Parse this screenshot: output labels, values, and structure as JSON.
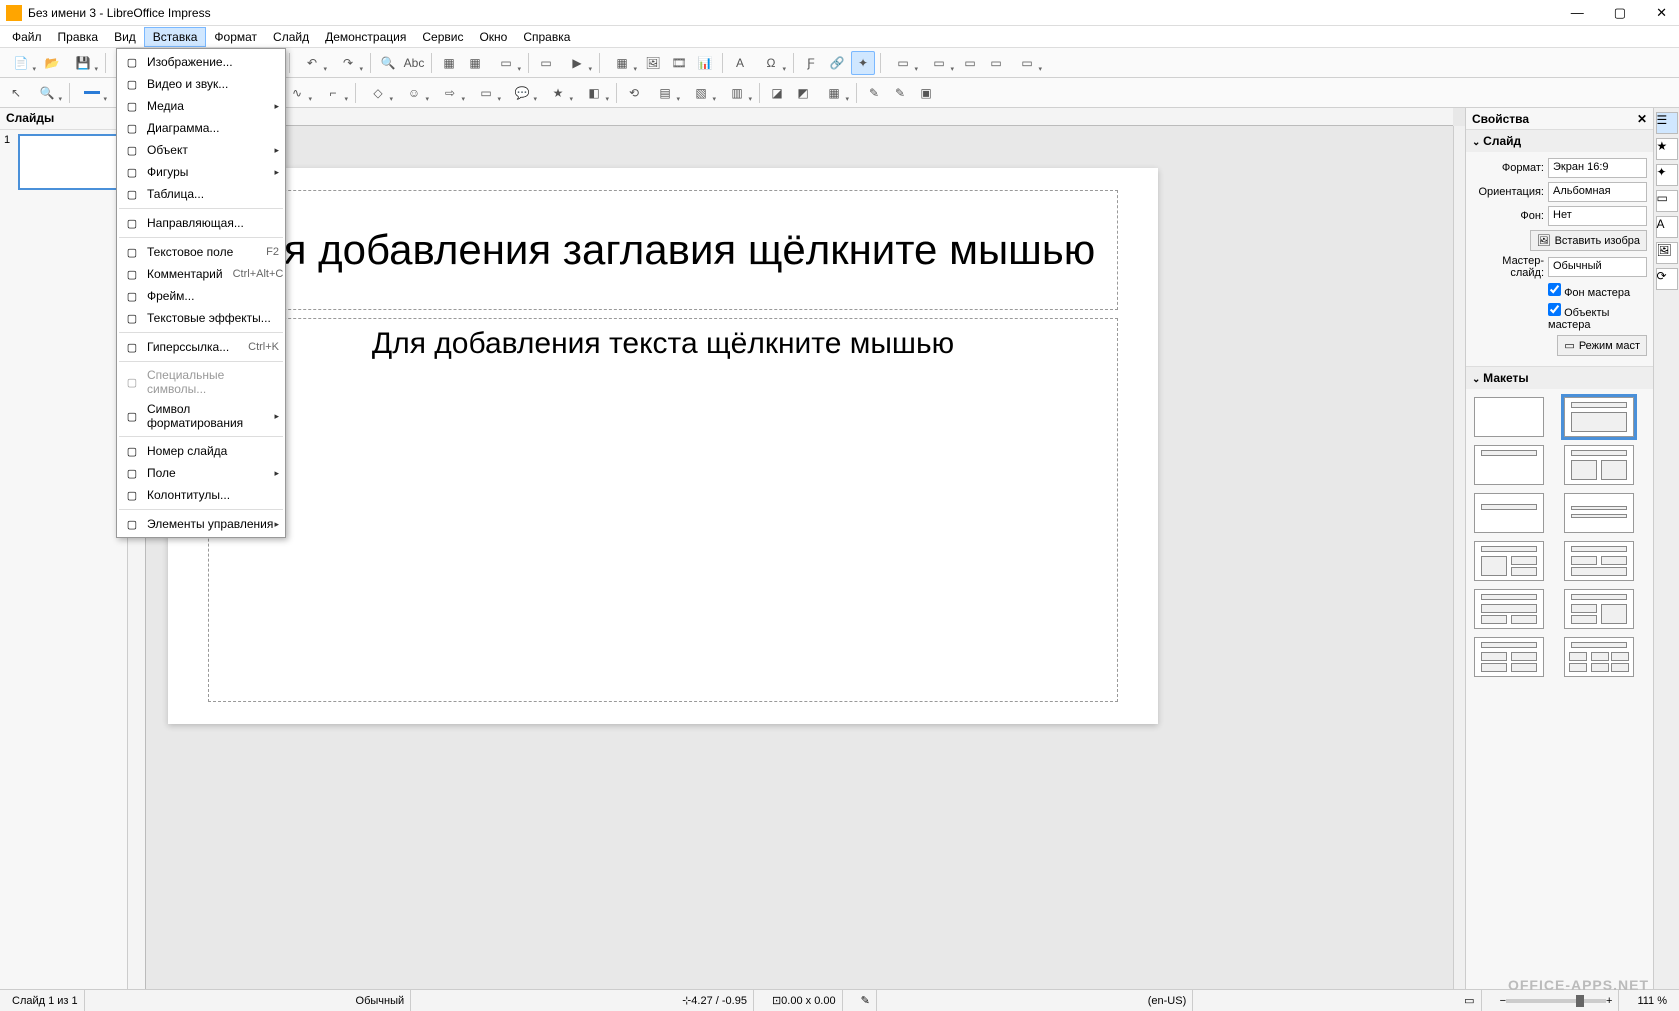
{
  "title": "Без имени 3 - LibreOffice Impress",
  "menubar": [
    "Файл",
    "Правка",
    "Вид",
    "Вставка",
    "Формат",
    "Слайд",
    "Демонстрация",
    "Сервис",
    "Окно",
    "Справка"
  ],
  "active_menu_index": 3,
  "dropdown": {
    "items": [
      {
        "icon": "image-icon",
        "label": "Изображение...",
        "shortcut": "",
        "submenu": false
      },
      {
        "icon": "video-icon",
        "label": "Видео и звук...",
        "shortcut": "",
        "submenu": false
      },
      {
        "icon": "media-icon",
        "label": "Медиа",
        "shortcut": "",
        "submenu": true
      },
      {
        "icon": "chart-icon",
        "label": "Диаграмма...",
        "shortcut": "",
        "submenu": false
      },
      {
        "icon": "object-icon",
        "label": "Объект",
        "shortcut": "",
        "submenu": true
      },
      {
        "icon": "shapes-icon",
        "label": "Фигуры",
        "shortcut": "",
        "submenu": true
      },
      {
        "icon": "table-icon",
        "label": "Таблица...",
        "shortcut": "",
        "submenu": false
      },
      {
        "sep": true
      },
      {
        "icon": "guide-icon",
        "label": "Направляющая...",
        "shortcut": "",
        "submenu": false
      },
      {
        "sep": true
      },
      {
        "icon": "textbox-icon",
        "label": "Текстовое поле",
        "shortcut": "F2",
        "submenu": false
      },
      {
        "icon": "comment-icon",
        "label": "Комментарий",
        "shortcut": "Ctrl+Alt+C",
        "submenu": false
      },
      {
        "icon": "frame-icon",
        "label": "Фрейм...",
        "shortcut": "",
        "submenu": false
      },
      {
        "icon": "texteffect-icon",
        "label": "Текстовые эффекты...",
        "shortcut": "",
        "submenu": false
      },
      {
        "sep": true
      },
      {
        "icon": "link-icon",
        "label": "Гиперссылка...",
        "shortcut": "Ctrl+K",
        "submenu": false
      },
      {
        "sep": true
      },
      {
        "icon": "special-icon",
        "label": "Специальные символы...",
        "shortcut": "",
        "submenu": false,
        "disabled": true
      },
      {
        "icon": "format-mark-icon",
        "label": "Символ форматирования",
        "shortcut": "",
        "submenu": true
      },
      {
        "sep": true
      },
      {
        "icon": "slidenum-icon",
        "label": "Номер слайда",
        "shortcut": "",
        "submenu": false
      },
      {
        "icon": "field-icon",
        "label": "Поле",
        "shortcut": "",
        "submenu": true
      },
      {
        "icon": "header-footer-icon",
        "label": "Колонтитулы...",
        "shortcut": "",
        "submenu": false
      },
      {
        "sep": true
      },
      {
        "icon": "controls-icon",
        "label": "Элементы управления",
        "shortcut": "",
        "submenu": true
      }
    ]
  },
  "slides_panel": {
    "title": "Слайды",
    "items": [
      {
        "num": "1"
      }
    ]
  },
  "canvas": {
    "title_placeholder": "Для добавления заглавия щёлкните мышью",
    "body_placeholder": "Для добавления текста щёлкните мышью"
  },
  "sidebar": {
    "title": "Свойства",
    "slide_section": {
      "title": "Слайд",
      "format_label": "Формат:",
      "format_value": "Экран 16:9",
      "orient_label": "Ориентация:",
      "orient_value": "Альбомная",
      "bg_label": "Фон:",
      "bg_value": "Нет",
      "insert_image_btn": "Вставить изобра",
      "master_label": "Мастер-слайд:",
      "master_value": "Обычный",
      "master_bg_check": "Фон мастера",
      "master_obj_check": "Объекты мастера",
      "master_mode_btn": "Режим маст"
    },
    "layouts_section": {
      "title": "Макеты"
    }
  },
  "statusbar": {
    "slide": "Слайд 1 из 1",
    "master": "Обычный",
    "pos": "4.27 / -0.95",
    "size": "0.00 x 0.00",
    "lang": "(en-US)",
    "zoom": "111 %"
  },
  "watermark": "OFFICE-APPS.NET"
}
